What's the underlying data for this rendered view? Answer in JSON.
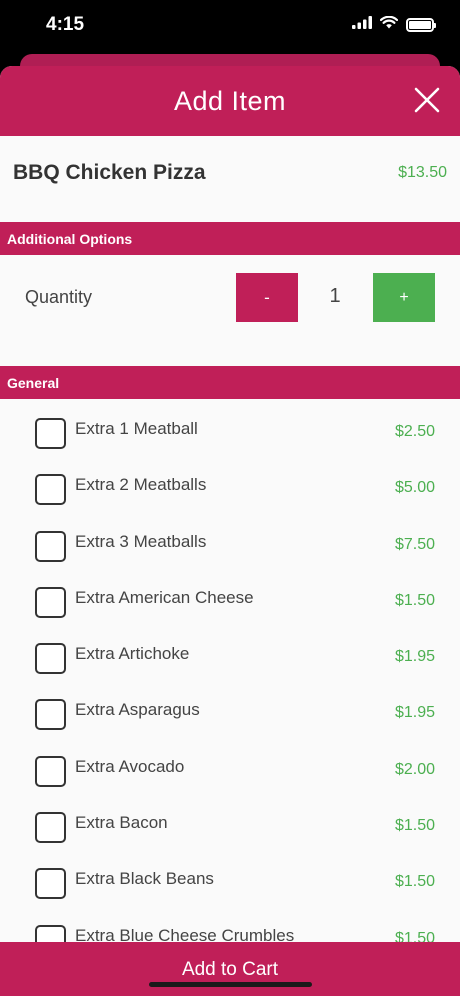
{
  "status_bar": {
    "time": "4:15"
  },
  "header": {
    "title": "Add Item"
  },
  "item": {
    "name": "BBQ Chicken Pizza",
    "price": "$13.50"
  },
  "sections": {
    "additional_options": "Additional Options",
    "general": "General"
  },
  "quantity": {
    "label": "Quantity",
    "minus_label": "-",
    "value": "1",
    "plus_label": "+"
  },
  "options": [
    {
      "label": "Extra 1 Meatball",
      "price": "$2.50"
    },
    {
      "label": "Extra 2 Meatballs",
      "price": "$5.00"
    },
    {
      "label": "Extra 3 Meatballs",
      "price": "$7.50"
    },
    {
      "label": "Extra American Cheese",
      "price": "$1.50"
    },
    {
      "label": "Extra Artichoke",
      "price": "$1.95"
    },
    {
      "label": "Extra Asparagus",
      "price": "$1.95"
    },
    {
      "label": "Extra Avocado",
      "price": "$2.00"
    },
    {
      "label": "Extra Bacon",
      "price": "$1.50"
    },
    {
      "label": "Extra Black Beans",
      "price": "$1.50"
    },
    {
      "label": "Extra Blue Cheese Crumbles",
      "price": "$1.50"
    }
  ],
  "footer": {
    "add_to_cart_label": "Add to Cart"
  },
  "colors": {
    "brand": "#c01f58",
    "price_green": "#4caf50",
    "plus_green": "#4caf50"
  }
}
